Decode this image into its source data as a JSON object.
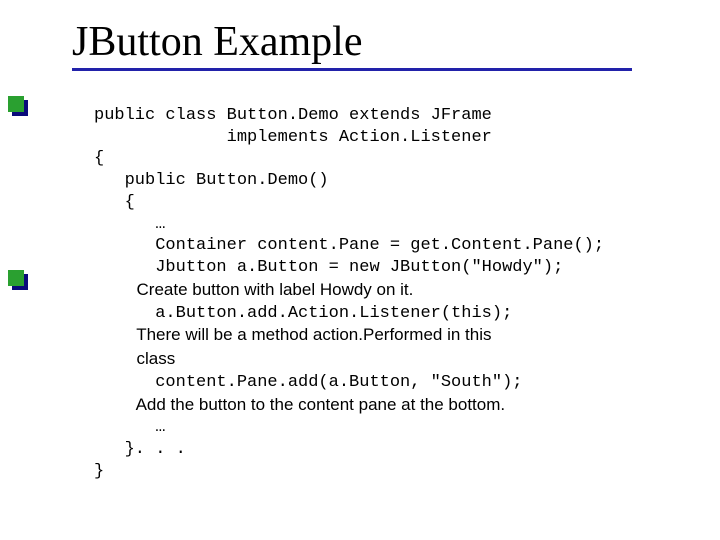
{
  "title": "JButton Example",
  "code": {
    "l1": "public class Button.Demo extends JFrame",
    "l2": "             implements Action.Listener",
    "l3": "{",
    "l4": "   public Button.Demo()",
    "l5": "   {",
    "l6": "      …",
    "l7": "      Container content.Pane = get.Content.Pane();",
    "l8": "      Jbutton a.Button = new JButton(\"Howdy\");",
    "c1": "         Create button with label Howdy on it.",
    "l9": "      a.Button.add.Action.Listener(this);",
    "c2": "         There will be a method action.Performed in this",
    "c3": "         class",
    "l10": "      content.Pane.add(a.Button, \"South\");",
    "c4": "         Add the button to the content pane at the bottom.",
    "l11": "      …",
    "l12": "   }. . .",
    "l13": "}"
  }
}
